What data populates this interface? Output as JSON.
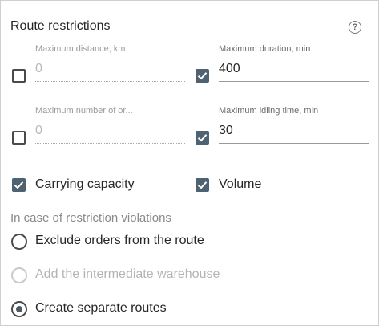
{
  "title": "Route restrictions",
  "help_icon": "help-circle-icon",
  "fields": [
    {
      "label": "Maximum distance, km",
      "value": "0",
      "checked": false
    },
    {
      "label": "Maximum duration, min",
      "value": "400",
      "checked": true
    },
    {
      "label": "Maximum number of or...",
      "value": "0",
      "checked": false
    },
    {
      "label": "Maximum idling time, min",
      "value": "30",
      "checked": true
    }
  ],
  "options": {
    "carrying_capacity": {
      "label": "Carrying capacity",
      "checked": true
    },
    "volume": {
      "label": "Volume",
      "checked": true
    }
  },
  "violations": {
    "heading": "In case of restriction violations",
    "choices": [
      {
        "label": "Exclude orders from the route",
        "selected": false,
        "disabled": false
      },
      {
        "label": "Add the intermediate warehouse",
        "selected": false,
        "disabled": true
      },
      {
        "label": "Create separate routes",
        "selected": true,
        "disabled": false
      }
    ]
  },
  "colors": {
    "checkbox_checked": "#4f6272",
    "disabled_text": "#b8b8b8"
  }
}
